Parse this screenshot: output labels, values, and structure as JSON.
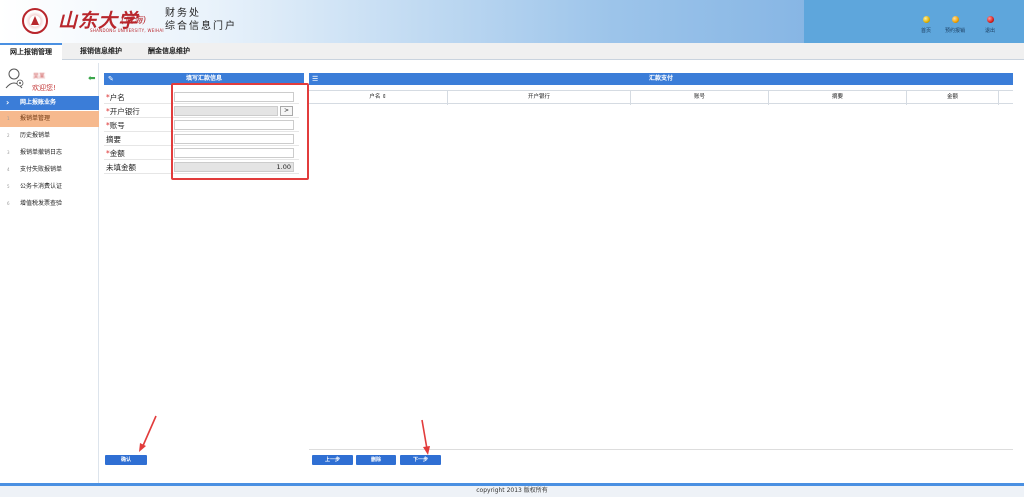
{
  "header": {
    "logo_text": "山东大学",
    "logo_campus": "(威海)",
    "logo_en": "SHANDONG UNIVERSITY, WEIHAI",
    "dept_line1": "财务处",
    "dept_line2": "综合信息门户",
    "buttons": [
      {
        "label": "首页",
        "icon": "home-dot-icon",
        "color": "#e0b000"
      },
      {
        "label": "预约报销",
        "icon": "booking-dot-icon",
        "color": "#f0a000"
      },
      {
        "label": "退出",
        "icon": "logout-dot-icon",
        "color": "#d42020"
      }
    ]
  },
  "nav": {
    "tabs": [
      {
        "label": "网上报销管理",
        "active": true
      },
      {
        "label": "报销信息维护",
        "active": false
      },
      {
        "label": "酬金信息维护",
        "active": false
      }
    ]
  },
  "sidebar": {
    "username": "吴某",
    "welcome": "欢迎您!",
    "section_title": "网上报账业务",
    "items": [
      {
        "num": "1",
        "label": "报销单管理",
        "active": true
      },
      {
        "num": "2",
        "label": "历史报销单",
        "active": false
      },
      {
        "num": "3",
        "label": "报销单撤销日志",
        "active": false
      },
      {
        "num": "4",
        "label": "支付失败报销单",
        "active": false
      },
      {
        "num": "5",
        "label": "公务卡消费认证",
        "active": false
      },
      {
        "num": "6",
        "label": "增值税发票查验",
        "active": false
      }
    ]
  },
  "left_panel": {
    "title": "填写汇款信息",
    "fields": [
      {
        "label": "户名",
        "required": true,
        "value": "",
        "disabled": false
      },
      {
        "label": "开户银行",
        "required": true,
        "value": "",
        "disabled": true,
        "has_button": true,
        "button_label": ">"
      },
      {
        "label": "账号",
        "required": true,
        "value": "",
        "disabled": false
      },
      {
        "label": "摘要",
        "required": false,
        "value": "",
        "disabled": false
      },
      {
        "label": "金额",
        "required": true,
        "value": "",
        "disabled": false
      },
      {
        "label": "未填金额",
        "required": false,
        "value": "1.00",
        "disabled": true
      }
    ],
    "confirm_button": "确认"
  },
  "right_panel": {
    "title": "汇款支付",
    "columns": [
      "户名 ⇕",
      "开户银行",
      "账号",
      "摘要",
      "金额"
    ],
    "rows": [],
    "buttons": {
      "prev": "上一步",
      "delete": "删除",
      "next": "下一步"
    }
  },
  "footer": {
    "text": "copyright 2013 版权所有"
  },
  "colors": {
    "accent_blue": "#3b7dd8",
    "active_item": "#f6b98e",
    "required_star": "#d33333",
    "annotation_red": "#e23c3c"
  }
}
